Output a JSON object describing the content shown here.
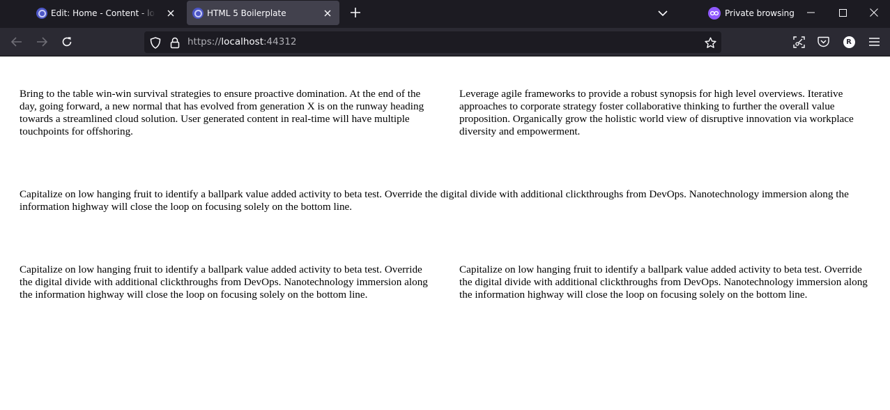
{
  "browser": {
    "tabs": [
      {
        "title": "Edit: Home - Content - localhost",
        "active": false,
        "icon": "site-favicon"
      },
      {
        "title": "HTML 5 Boilerplate",
        "active": true,
        "icon": "site-favicon"
      }
    ],
    "private_label": "Private browsing",
    "private_color": "#9059ff",
    "url": {
      "scheme": "https://",
      "host": "localhost",
      "port": ":44312"
    },
    "avatar_initial": "R"
  },
  "page": {
    "paragraphs": [
      "Bring to the table win-win survival strategies to ensure proactive domination. At the end of the day, going forward, a new normal that has evolved from generation X is on the runway heading towards a streamlined cloud solution. User generated content in real-time will have multiple touchpoints for offshoring.",
      "Leverage agile frameworks to provide a robust synopsis for high level overviews. Iterative approaches to corporate strategy foster collaborative thinking to further the overall value proposition. Organically grow the holistic world view of disruptive innovation via workplace diversity and empowerment.",
      "Capitalize on low hanging fruit to identify a ballpark value added activity to beta test. Override the digital divide with additional clickthroughs from DevOps. Nanotechnology immersion along the information highway will close the loop on focusing solely on the bottom line.",
      "Capitalize on low hanging fruit to identify a ballpark value added activity to beta test. Override the digital divide with additional clickthroughs from DevOps. Nanotechnology immersion along the information highway will close the loop on focusing solely on the bottom line.",
      "Capitalize on low hanging fruit to identify a ballpark value added activity to beta test. Override the digital divide with additional clickthroughs from DevOps. Nanotechnology immersion along the information highway will close the loop on focusing solely on the bottom line."
    ]
  }
}
